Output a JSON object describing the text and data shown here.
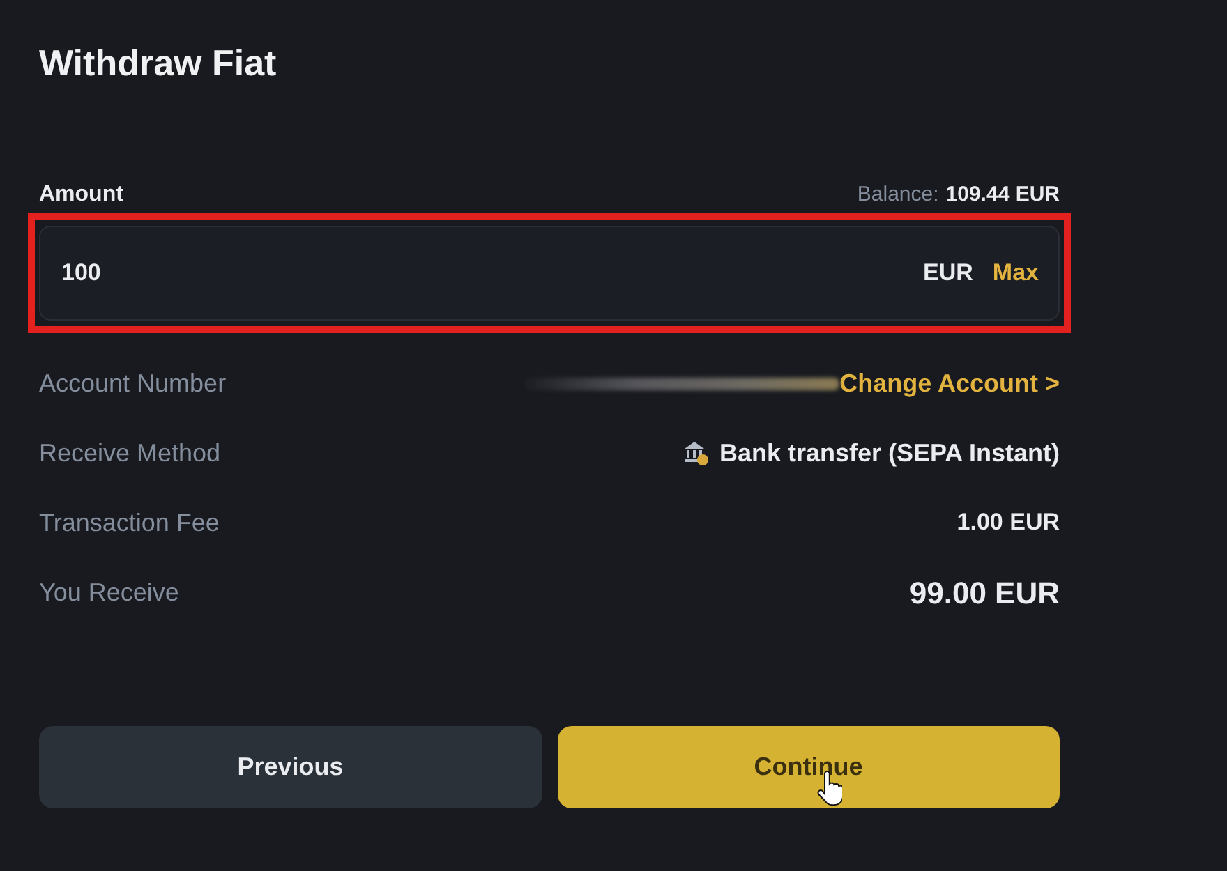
{
  "title": "Withdraw Fiat",
  "amount": {
    "label": "Amount",
    "balance_label": "Balance:",
    "balance_value": "109.44 EUR",
    "value": "100",
    "currency": "EUR",
    "max": "Max",
    "highlighted": true
  },
  "details": [
    {
      "kind": "masked",
      "label": "Account Number",
      "link": "Change Account >"
    },
    {
      "kind": "method",
      "label": "Receive Method",
      "value": "Bank transfer (SEPA Instant)"
    },
    {
      "kind": "plain",
      "label": "Transaction Fee",
      "value": "1.00 EUR"
    },
    {
      "kind": "total",
      "label": "You Receive",
      "value": "99.00 EUR"
    }
  ],
  "buttons": [
    {
      "label": "Previous",
      "kind": "secondary",
      "hovered": false
    },
    {
      "label": "Continue",
      "kind": "primary",
      "hovered": true
    }
  ]
}
